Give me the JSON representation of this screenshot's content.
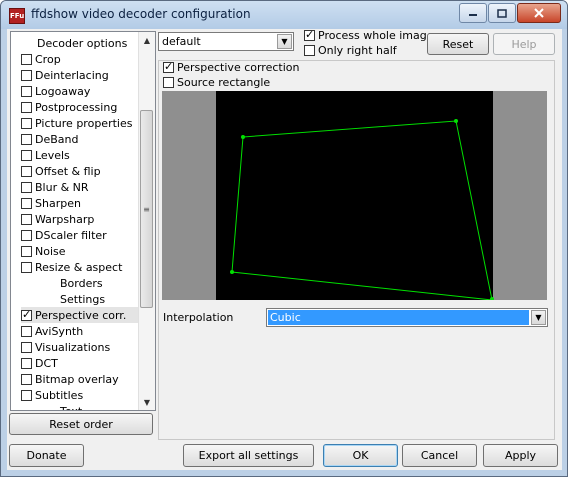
{
  "window": {
    "title": "ffdshow video decoder configuration",
    "icon_text": "FFu"
  },
  "tree": {
    "header": "Decoder options",
    "items": [
      {
        "label": "Crop",
        "checked": false
      },
      {
        "label": "Deinterlacing",
        "checked": false
      },
      {
        "label": "Logoaway",
        "checked": false
      },
      {
        "label": "Postprocessing",
        "checked": false
      },
      {
        "label": "Picture properties",
        "checked": false
      },
      {
        "label": "DeBand",
        "checked": false
      },
      {
        "label": "Levels",
        "checked": false
      },
      {
        "label": "Offset & flip",
        "checked": false
      },
      {
        "label": "Blur & NR",
        "checked": false
      },
      {
        "label": "Sharpen",
        "checked": false
      },
      {
        "label": "Warpsharp",
        "checked": false
      },
      {
        "label": "DScaler filter",
        "checked": false
      },
      {
        "label": "Noise",
        "checked": false
      },
      {
        "label": "Resize & aspect",
        "checked": false
      },
      {
        "label": "Borders",
        "sub": true
      },
      {
        "label": "Settings",
        "sub": true
      },
      {
        "label": "Perspective corr.",
        "checked": true,
        "selected": true
      },
      {
        "label": "AviSynth",
        "checked": false
      },
      {
        "label": "Visualizations",
        "checked": false
      },
      {
        "label": "DCT",
        "checked": false
      },
      {
        "label": "Bitmap overlay",
        "checked": false
      },
      {
        "label": "Subtitles",
        "checked": false
      },
      {
        "label": "Text",
        "sub": true
      }
    ]
  },
  "preset": {
    "value": "default"
  },
  "options": {
    "process_whole_image": "Process whole image",
    "only_right_half": "Only right half"
  },
  "buttons": {
    "reset": "Reset",
    "help": "Help",
    "reset_order": "Reset order",
    "donate": "Donate",
    "export": "Export all settings",
    "ok": "OK",
    "cancel": "Cancel",
    "apply": "Apply"
  },
  "perspective": {
    "correction_label": "Perspective correction",
    "source_rect_label": "Source rectangle",
    "interpolation_label": "Interpolation",
    "interpolation_value": "Cubic"
  },
  "colors": {
    "quad_line": "#00e000",
    "selection": "#3399ff"
  }
}
